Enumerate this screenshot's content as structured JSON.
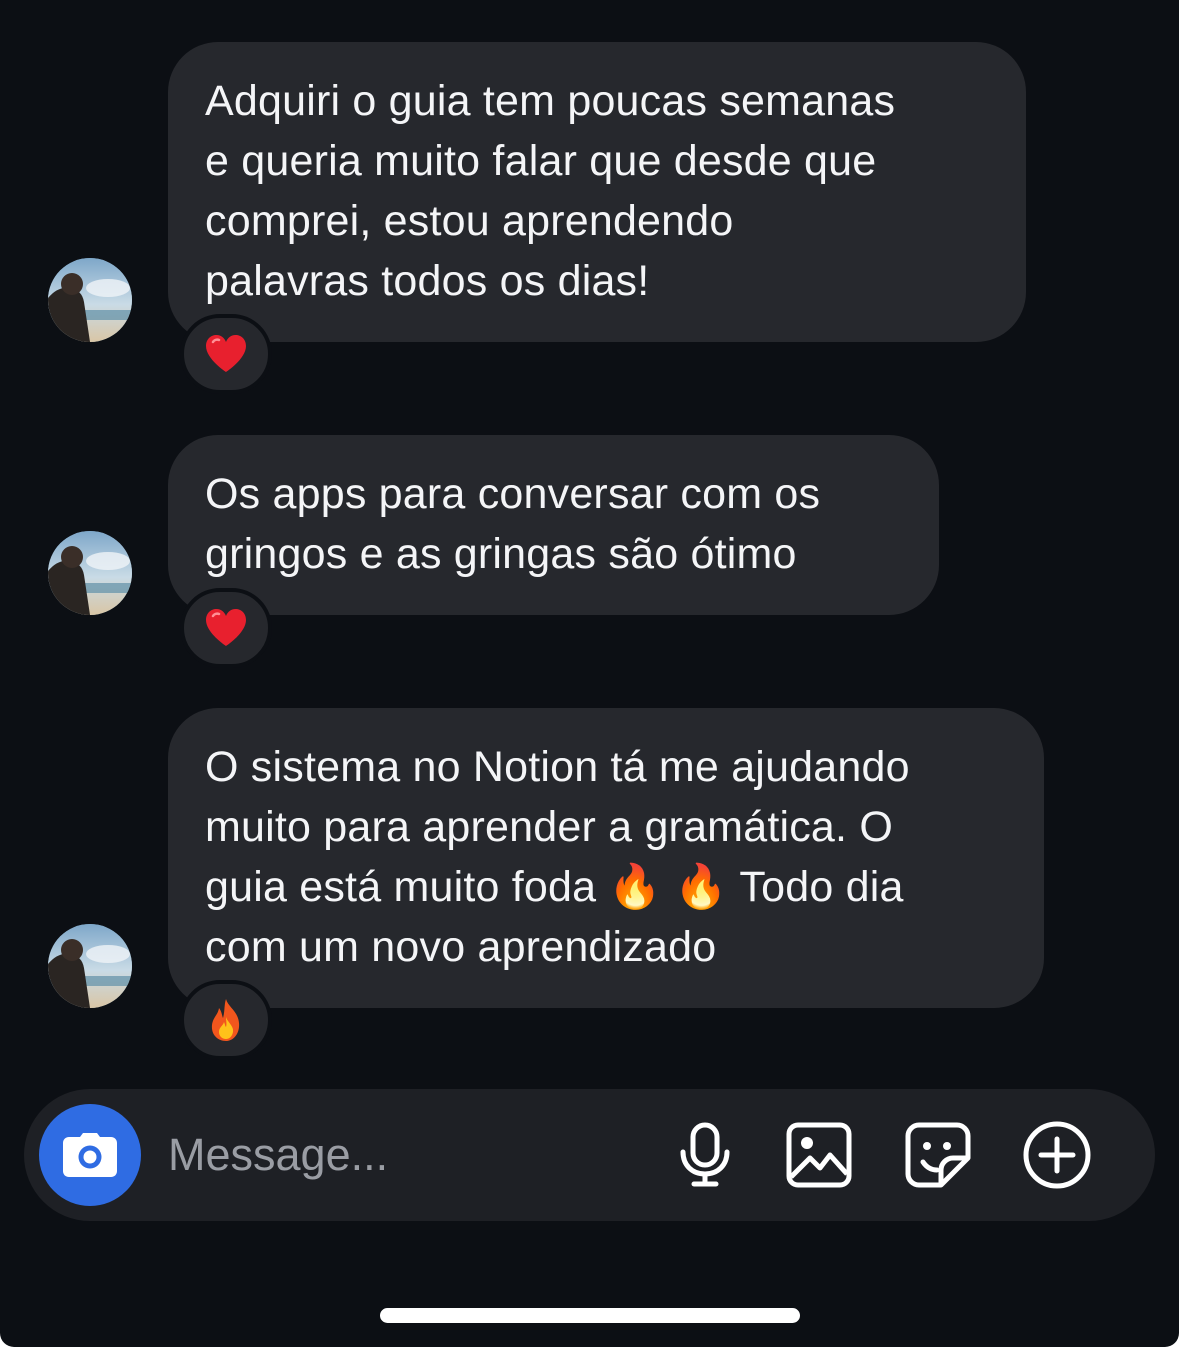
{
  "conversation": {
    "messages": [
      {
        "text": "Adquiri o guia tem poucas semanas\ne queria muito falar que desde que\ncomprei, estou aprendendo\npalavras todos os dias!",
        "reaction": "❤️",
        "reaction_icon": "heart"
      },
      {
        "text": "Os apps para conversar com os\ngringos e as gringas são ótimo",
        "reaction": "❤️",
        "reaction_icon": "heart"
      },
      {
        "text": "O sistema no Notion tá me ajudando\nmuito para aprender a gramática. O\nguia está muito foda 🔥 🔥  Todo dia\ncom um novo aprendizado",
        "reaction": "🔥",
        "reaction_icon": "fire"
      }
    ]
  },
  "composer": {
    "placeholder": "Message...",
    "camera_icon": "camera-icon",
    "tools": [
      "microphone-icon",
      "image-icon",
      "sticker-icon",
      "plus-circle-icon"
    ]
  },
  "colors": {
    "background": "#0c0f14",
    "bubble": "#26282d",
    "accent": "#2f6ce3",
    "text": "#f4f5f7",
    "placeholder": "#9a9da4"
  }
}
